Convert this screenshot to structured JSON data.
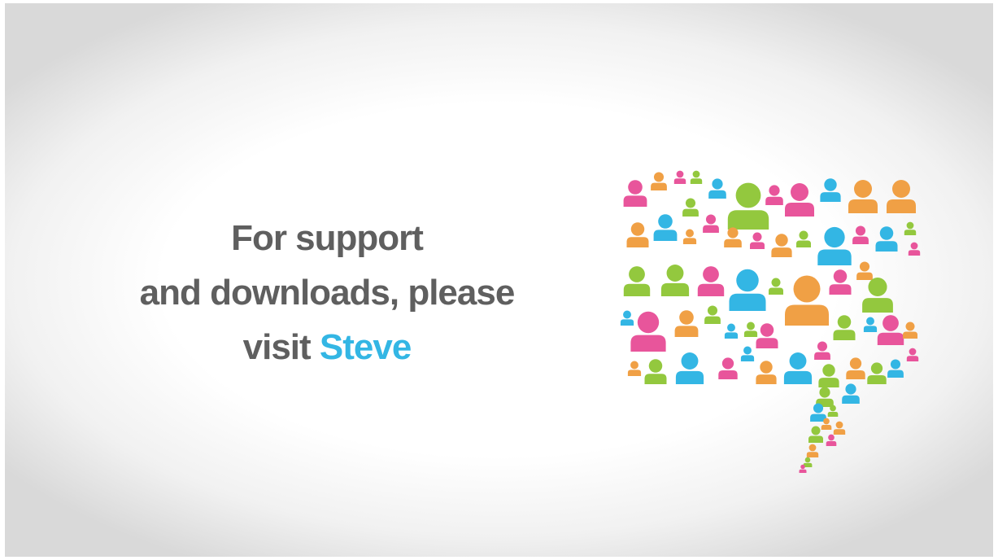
{
  "message": {
    "line1": "For support",
    "line2": "and downloads, please",
    "line3_prefix": "visit ",
    "line3_highlight": "Steve"
  },
  "colors": {
    "text": "#5f5f5f",
    "accent": "#33b6e4",
    "people": [
      "#e8559b",
      "#f0a045",
      "#93c83e",
      "#33b6e4"
    ]
  },
  "graphic": {
    "name": "people-speech-bubble",
    "figure_icon": "person-icon"
  }
}
